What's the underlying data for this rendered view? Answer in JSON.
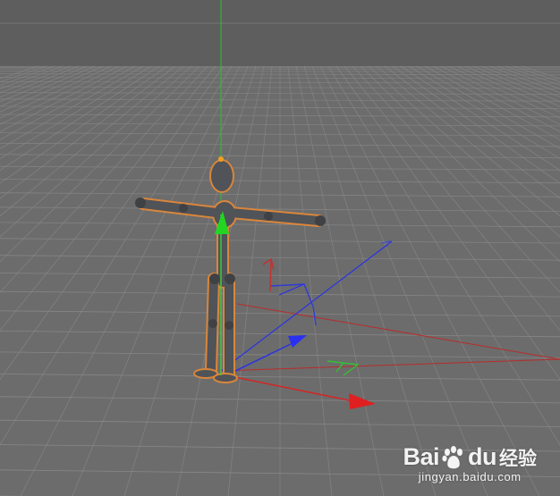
{
  "viewport": {
    "background_color": "#5e5e5e",
    "floor_color": "#6d6d6d",
    "grid_line_color": "#8a8a8a",
    "horizon_color": "#7a7a7a"
  },
  "scene": {
    "character_name": "mannequin-figure",
    "selection_outline_color": "#d9863c",
    "body_color": "#4f5256",
    "world_axis_colors": {
      "x": "#d32626",
      "y": "#2fbf2f",
      "z": "#2a34e0"
    },
    "gizmo_arrows": [
      "x-arrow-icon",
      "y-arrow-icon",
      "z-arrow-icon"
    ],
    "view_cube_axes": [
      "x-axis-icon",
      "y-axis-icon",
      "z-axis-icon"
    ]
  },
  "watermark": {
    "brand_left": "Bai",
    "brand_right": "du",
    "brand_cn": "经验",
    "site": "jingyan.baidu.com",
    "icon": "paw-icon"
  }
}
